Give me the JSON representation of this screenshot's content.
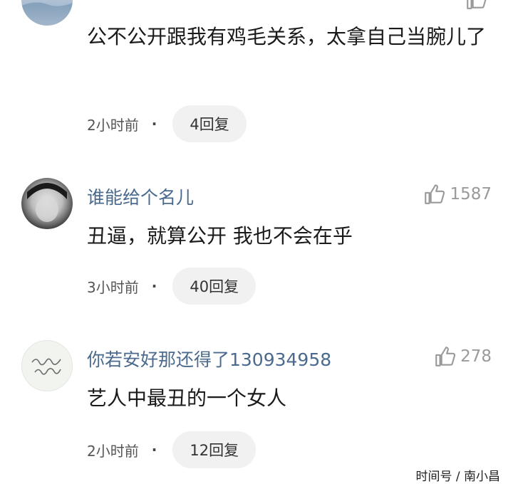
{
  "comments": [
    {
      "username": "",
      "likes": "",
      "content": "公不公开跟我有鸡毛关系，太拿自己当腕儿了",
      "time": "2小时前",
      "replies": "4回复"
    },
    {
      "username": "谁能给个名儿",
      "likes": "1587",
      "content": "丑逼，就算公开 我也不会在乎",
      "time": "3小时前",
      "replies": "40回复"
    },
    {
      "username": "你若安好那还得了130934958",
      "likes": "278",
      "content": "艺人中最丑的一个女人",
      "time": "2小时前",
      "replies": "12回复"
    }
  ],
  "separator": "·",
  "watermark": "时间号 / 南小昌",
  "icons": {
    "like": "thumbs-up-icon"
  }
}
